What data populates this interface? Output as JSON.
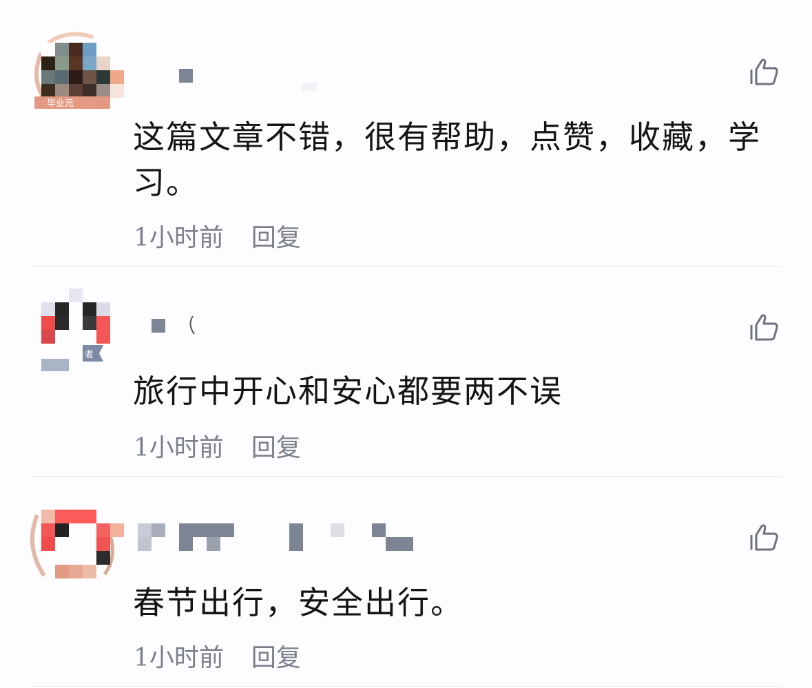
{
  "comments": [
    {
      "text": "这篇文章不错，很有帮助，点赞，收藏，学习。",
      "time": "1小时前",
      "reply_label": "回复",
      "avatar_badge": "毕业元"
    },
    {
      "text": "旅行中开心和安心都要两不误",
      "time": "1小时前",
      "reply_label": "回复",
      "avatar_badge": "者"
    },
    {
      "text": "春节出行，安全出行。",
      "time": "1小时前",
      "reply_label": "回复"
    }
  ],
  "icons": {
    "like": "thumbs-up-icon"
  },
  "colors": {
    "text": "#141414",
    "meta": "#7a7f8a",
    "divider": "#e4e5ea",
    "background": "#fdfdff"
  }
}
